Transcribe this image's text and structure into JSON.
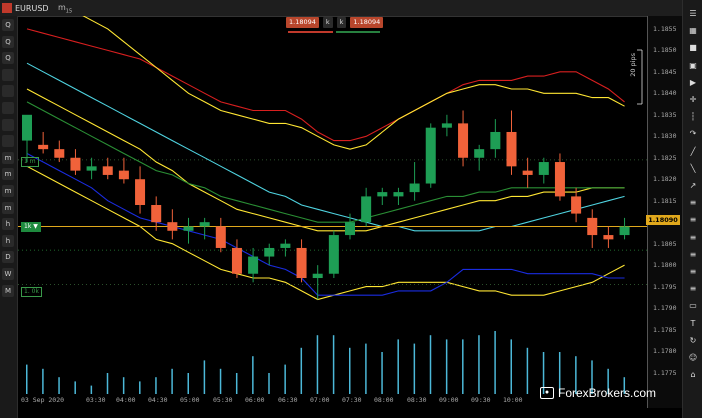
{
  "window": {
    "symbol": "EURUSD",
    "timeframe": "m",
    "timeframe_sub": "15"
  },
  "trade": {
    "sell_price": "1.18094",
    "sell_qty": "k",
    "buy_qty": "k",
    "buy_price": "1.18094"
  },
  "current_price": "1.18090",
  "pips_label": "20 pips",
  "left_toolbar": [
    "Q",
    "Q",
    "Q",
    "",
    "",
    "",
    "",
    "",
    "m",
    "m",
    "m",
    "m",
    "h",
    "h",
    "D",
    "W",
    "M"
  ],
  "level_labels": {
    "upper": "1 m",
    "trade": "1k ▼",
    "lower": "1. 0k"
  },
  "watermark": "ForexBrokers.com",
  "colors": {
    "bull": "#1e9e55",
    "bear": "#f0623a",
    "ema_yellow": "#ffe633",
    "bb_red": "#d81f1f",
    "cyan": "#4fd3e0",
    "blue": "#1a2ce0",
    "green_ma": "#2a8f35",
    "volume": "#4cb8d8"
  },
  "chart_data": {
    "type": "candlestick",
    "title": "",
    "ylim": [
      1.177,
      1.1858
    ],
    "y_ticks": [
      "1.1855",
      "1.1850",
      "1.1845",
      "1.1840",
      "1.1835",
      "1.1830",
      "1.1825",
      "1.1820",
      "1.1815",
      "1.1810",
      "1.1805",
      "1.1800",
      "1.1795",
      "1.1790",
      "1.1785",
      "1.1780",
      "1.1775"
    ],
    "x_ticks": [
      "03 Sep 2020",
      "03:30",
      "04:00",
      "04:30",
      "05:00",
      "05:30",
      "06:00",
      "06:30",
      "07:00",
      "07:30",
      "08:00",
      "08:30",
      "09:00",
      "09:30",
      "10:00"
    ],
    "candles": [
      {
        "o": 1.1829,
        "h": 1.1834,
        "l": 1.1824,
        "c": 1.1835
      },
      {
        "o": 1.1828,
        "h": 1.1831,
        "l": 1.1826,
        "c": 1.1827
      },
      {
        "o": 1.1827,
        "h": 1.1829,
        "l": 1.1824,
        "c": 1.1825
      },
      {
        "o": 1.1825,
        "h": 1.1827,
        "l": 1.1821,
        "c": 1.1822
      },
      {
        "o": 1.1822,
        "h": 1.1825,
        "l": 1.182,
        "c": 1.1823
      },
      {
        "o": 1.1823,
        "h": 1.1825,
        "l": 1.182,
        "c": 1.1821
      },
      {
        "o": 1.1822,
        "h": 1.1825,
        "l": 1.1819,
        "c": 1.182
      },
      {
        "o": 1.182,
        "h": 1.1823,
        "l": 1.1812,
        "c": 1.1814
      },
      {
        "o": 1.1814,
        "h": 1.1816,
        "l": 1.1808,
        "c": 1.181
      },
      {
        "o": 1.181,
        "h": 1.1813,
        "l": 1.1806,
        "c": 1.1808
      },
      {
        "o": 1.1808,
        "h": 1.1811,
        "l": 1.1805,
        "c": 1.1809
      },
      {
        "o": 1.1809,
        "h": 1.1811,
        "l": 1.1806,
        "c": 1.181
      },
      {
        "o": 1.1809,
        "h": 1.1811,
        "l": 1.1803,
        "c": 1.1804
      },
      {
        "o": 1.1804,
        "h": 1.1806,
        "l": 1.1797,
        "c": 1.1798
      },
      {
        "o": 1.1798,
        "h": 1.1804,
        "l": 1.1796,
        "c": 1.1802
      },
      {
        "o": 1.1802,
        "h": 1.1805,
        "l": 1.18,
        "c": 1.1804
      },
      {
        "o": 1.1804,
        "h": 1.1806,
        "l": 1.1802,
        "c": 1.1805
      },
      {
        "o": 1.1804,
        "h": 1.1806,
        "l": 1.1796,
        "c": 1.1797
      },
      {
        "o": 1.1797,
        "h": 1.18,
        "l": 1.1792,
        "c": 1.1798
      },
      {
        "o": 1.1798,
        "h": 1.1808,
        "l": 1.1797,
        "c": 1.1807
      },
      {
        "o": 1.1807,
        "h": 1.1812,
        "l": 1.1806,
        "c": 1.181
      },
      {
        "o": 1.181,
        "h": 1.1818,
        "l": 1.1809,
        "c": 1.1816
      },
      {
        "o": 1.1816,
        "h": 1.1818,
        "l": 1.1814,
        "c": 1.1817
      },
      {
        "o": 1.1816,
        "h": 1.1818,
        "l": 1.1814,
        "c": 1.1817
      },
      {
        "o": 1.1817,
        "h": 1.1824,
        "l": 1.1815,
        "c": 1.1819
      },
      {
        "o": 1.1819,
        "h": 1.1833,
        "l": 1.1818,
        "c": 1.1832
      },
      {
        "o": 1.1832,
        "h": 1.1835,
        "l": 1.183,
        "c": 1.1833
      },
      {
        "o": 1.1833,
        "h": 1.1836,
        "l": 1.1823,
        "c": 1.1825
      },
      {
        "o": 1.1825,
        "h": 1.1828,
        "l": 1.1822,
        "c": 1.1827
      },
      {
        "o": 1.1827,
        "h": 1.1834,
        "l": 1.1825,
        "c": 1.1831
      },
      {
        "o": 1.1831,
        "h": 1.1836,
        "l": 1.1821,
        "c": 1.1823
      },
      {
        "o": 1.1822,
        "h": 1.1825,
        "l": 1.1818,
        "c": 1.1821
      },
      {
        "o": 1.1821,
        "h": 1.1825,
        "l": 1.1819,
        "c": 1.1824
      },
      {
        "o": 1.1824,
        "h": 1.1826,
        "l": 1.1815,
        "c": 1.1816
      },
      {
        "o": 1.1816,
        "h": 1.1818,
        "l": 1.181,
        "c": 1.1812
      },
      {
        "o": 1.1811,
        "h": 1.1813,
        "l": 1.1804,
        "c": 1.1807
      },
      {
        "o": 1.1807,
        "h": 1.1809,
        "l": 1.1804,
        "c": 1.1806
      },
      {
        "o": 1.1807,
        "h": 1.1811,
        "l": 1.1806,
        "c": 1.1809
      }
    ],
    "series": [
      {
        "name": "",
        "color": "#d81f1f",
        "values": [
          1.1855,
          1.1854,
          1.1853,
          1.1852,
          1.1851,
          1.185,
          1.1849,
          1.1848,
          1.1846,
          1.1844,
          1.1842,
          1.184,
          1.1838,
          1.1837,
          1.1836,
          1.1836,
          1.1836,
          1.1834,
          1.1831,
          1.1829,
          1.1829,
          1.183,
          1.1832,
          1.1834,
          1.1836,
          1.1838,
          1.184,
          1.1842,
          1.1843,
          1.1843,
          1.1843,
          1.1844,
          1.1844,
          1.1845,
          1.1845,
          1.1843,
          1.1841,
          1.1838
        ]
      },
      {
        "name": "",
        "color": "#ffe633",
        "values": [
          1.1862,
          1.1861,
          1.186,
          1.1859,
          1.1857,
          1.1855,
          1.1852,
          1.1849,
          1.1846,
          1.1843,
          1.184,
          1.1838,
          1.1836,
          1.1835,
          1.1834,
          1.1833,
          1.1833,
          1.1832,
          1.183,
          1.1828,
          1.1827,
          1.1828,
          1.1831,
          1.1834,
          1.1836,
          1.1838,
          1.184,
          1.1841,
          1.1842,
          1.1842,
          1.1841,
          1.1841,
          1.184,
          1.184,
          1.184,
          1.1839,
          1.1839,
          1.1837
        ]
      },
      {
        "name": "",
        "color": "#4fd3e0",
        "values": [
          1.1847,
          1.1845,
          1.1843,
          1.1841,
          1.1839,
          1.1837,
          1.1835,
          1.1833,
          1.1831,
          1.1829,
          1.1827,
          1.1825,
          1.1823,
          1.1821,
          1.1819,
          1.1817,
          1.1816,
          1.1814,
          1.1813,
          1.1812,
          1.1811,
          1.181,
          1.1809,
          1.1809,
          1.1808,
          1.1808,
          1.1808,
          1.1808,
          1.1808,
          1.1809,
          1.1809,
          1.181,
          1.1811,
          1.1812,
          1.1813,
          1.1814,
          1.1815,
          1.1816
        ]
      },
      {
        "name": "",
        "color": "#ffe633",
        "values": [
          1.1841,
          1.1839,
          1.1837,
          1.1835,
          1.1833,
          1.1831,
          1.1829,
          1.1827,
          1.1824,
          1.1822,
          1.1819,
          1.1817,
          1.1815,
          1.1813,
          1.1812,
          1.1811,
          1.181,
          1.1809,
          1.1808,
          1.1808,
          1.1808,
          1.1808,
          1.1809,
          1.181,
          1.1811,
          1.1812,
          1.1813,
          1.1814,
          1.1815,
          1.1815,
          1.1816,
          1.1816,
          1.1817,
          1.1817,
          1.1817,
          1.1818,
          1.1818,
          1.1818
        ]
      },
      {
        "name": "",
        "color": "#2a8f35",
        "values": [
          1.1838,
          1.1836,
          1.1834,
          1.1832,
          1.183,
          1.1828,
          1.1826,
          1.1824,
          1.1822,
          1.1821,
          1.1819,
          1.1818,
          1.1816,
          1.1815,
          1.1814,
          1.1813,
          1.1812,
          1.1811,
          1.181,
          1.181,
          1.181,
          1.1811,
          1.1812,
          1.1813,
          1.1814,
          1.1815,
          1.1816,
          1.1816,
          1.1817,
          1.1817,
          1.1818,
          1.1818,
          1.1818,
          1.1818,
          1.1818,
          1.1818,
          1.1818,
          1.1818
        ]
      },
      {
        "name": "",
        "color": "#ffe633",
        "values": [
          1.1823,
          1.1821,
          1.1819,
          1.1817,
          1.1815,
          1.1813,
          1.1811,
          1.1809,
          1.1806,
          1.1805,
          1.1803,
          1.1801,
          1.1799,
          1.1798,
          1.1797,
          1.1797,
          1.1796,
          1.1794,
          1.1792,
          1.1793,
          1.1794,
          1.1795,
          1.1795,
          1.1796,
          1.1796,
          1.1796,
          1.1796,
          1.1795,
          1.1794,
          1.1794,
          1.1793,
          1.1793,
          1.1793,
          1.1794,
          1.1795,
          1.1796,
          1.1798,
          1.18
        ]
      },
      {
        "name": "",
        "color": "#1a2ce0",
        "values": [
          1.1826,
          1.1824,
          1.1822,
          1.182,
          1.1818,
          1.1815,
          1.1813,
          1.1811,
          1.181,
          1.1809,
          1.1808,
          1.1807,
          1.1806,
          1.1804,
          1.1802,
          1.18,
          1.1799,
          1.1797,
          1.1793,
          1.1793,
          1.1793,
          1.1793,
          1.1793,
          1.1794,
          1.1794,
          1.1794,
          1.1796,
          1.1799,
          1.1799,
          1.1799,
          1.1799,
          1.1798,
          1.1798,
          1.1798,
          1.1798,
          1.1798,
          1.1797,
          1.1797
        ]
      }
    ],
    "volume": [
      14,
      12,
      8,
      6,
      4,
      10,
      8,
      6,
      8,
      12,
      10,
      16,
      12,
      10,
      18,
      10,
      14,
      22,
      28,
      28,
      22,
      24,
      20,
      26,
      24,
      28,
      26,
      26,
      28,
      30,
      26,
      22,
      20,
      20,
      18,
      16,
      12,
      8
    ]
  }
}
